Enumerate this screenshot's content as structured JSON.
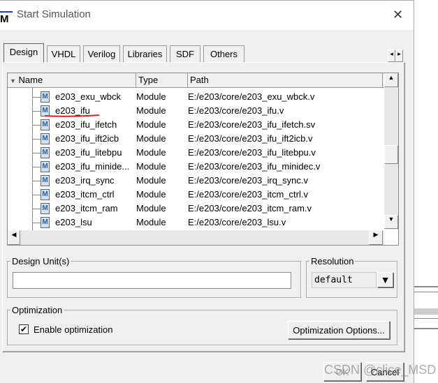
{
  "window": {
    "title": "Start Simulation",
    "logo": "M",
    "close_icon": "close-icon"
  },
  "tabs": [
    {
      "label": "Design",
      "active": true
    },
    {
      "label": "VHDL"
    },
    {
      "label": "Verilog"
    },
    {
      "label": "Libraries"
    },
    {
      "label": "SDF"
    },
    {
      "label": "Others"
    }
  ],
  "tree": {
    "columns": [
      "Name",
      "Type",
      "Path"
    ],
    "rows": [
      {
        "name": "e203_exu_wbck",
        "type": "Module",
        "path": "E:/e203/core/e203_exu_wbck.v"
      },
      {
        "name": "e203_ifu",
        "type": "Module",
        "path": "E:/e203/core/e203_ifu.v",
        "annotated": true
      },
      {
        "name": "e203_ifu_ifetch",
        "type": "Module",
        "path": "E:/e203/core/e203_ifu_ifetch.sv"
      },
      {
        "name": "e203_ifu_ift2icb",
        "type": "Module",
        "path": "E:/e203/core/e203_ifu_ift2icb.v"
      },
      {
        "name": "e203_ifu_litebpu",
        "type": "Module",
        "path": "E:/e203/core/e203_ifu_litebpu.v"
      },
      {
        "name": "e203_ifu_minide...",
        "type": "Module",
        "path": "E:/e203/core/e203_ifu_minidec.v"
      },
      {
        "name": "e203_irq_sync",
        "type": "Module",
        "path": "E:/e203/core/e203_irq_sync.v"
      },
      {
        "name": "e203_itcm_ctrl",
        "type": "Module",
        "path": "E:/e203/core/e203_itcm_ctrl.v"
      },
      {
        "name": "e203_itcm_ram",
        "type": "Module",
        "path": "E:/e203/core/e203_itcm_ram.v"
      },
      {
        "name": "e203_lsu",
        "type": "Module",
        "path": "E:/e203/core/e203_lsu.v"
      }
    ]
  },
  "design_unit": {
    "label": "Design Unit(s)",
    "value": ""
  },
  "resolution": {
    "label": "Resolution",
    "value": "default"
  },
  "optimization": {
    "label": "Optimization",
    "checkbox_label": "Enable optimization",
    "checked": true,
    "options_button": "Optimization Options..."
  },
  "buttons": {
    "ok": "OK",
    "cancel": "Cancel"
  },
  "watermark": "CSDN @clice_MSD"
}
